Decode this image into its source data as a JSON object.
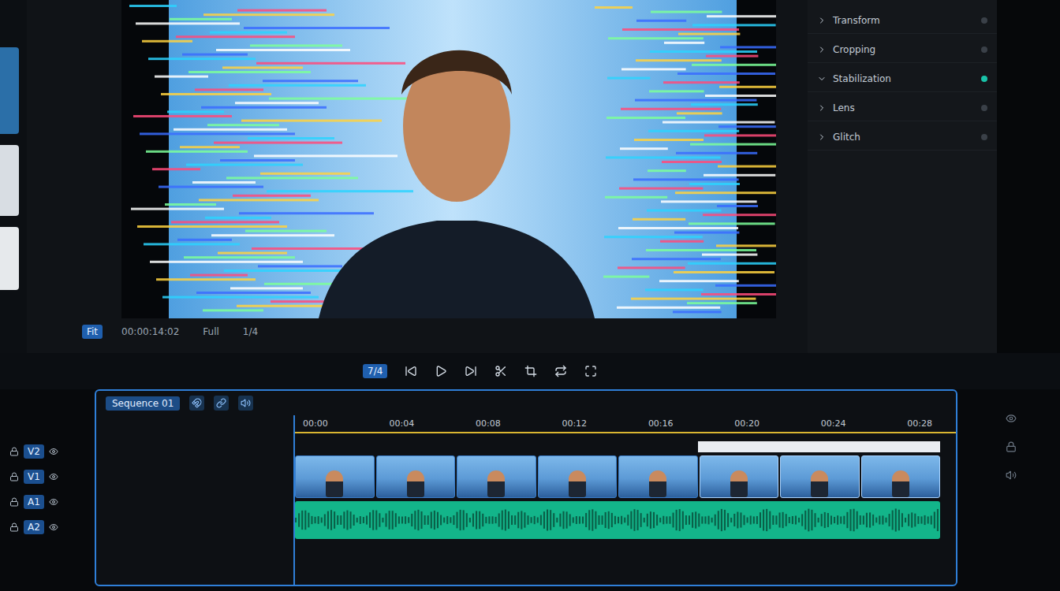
{
  "viewer": {
    "footer": [
      "Fit",
      "00:00:14:02",
      "Full",
      "1/4"
    ]
  },
  "transport": {
    "zoom": "7/4"
  },
  "inspector": {
    "items": [
      {
        "label": "Transform",
        "expanded": false,
        "enabled": false
      },
      {
        "label": "Cropping",
        "expanded": false,
        "enabled": false
      },
      {
        "label": "Stabilization",
        "expanded": true,
        "enabled": true
      },
      {
        "label": "Lens",
        "expanded": false,
        "enabled": false
      },
      {
        "label": "Glitch",
        "expanded": false,
        "enabled": false
      }
    ]
  },
  "timeline": {
    "title": "Sequence 01",
    "ruler": [
      "00:00",
      "00:04",
      "00:08",
      "00:12",
      "00:16",
      "00:20",
      "00:24",
      "00:28"
    ],
    "tracks": [
      {
        "name": "V2"
      },
      {
        "name": "V1"
      },
      {
        "name": "A1"
      },
      {
        "name": "A2"
      }
    ],
    "clips": [
      {
        "selected": false
      },
      {
        "selected": false
      },
      {
        "selected": false
      },
      {
        "selected": false
      },
      {
        "selected": false
      },
      {
        "selected": true
      },
      {
        "selected": true
      },
      {
        "selected": true
      }
    ]
  }
}
